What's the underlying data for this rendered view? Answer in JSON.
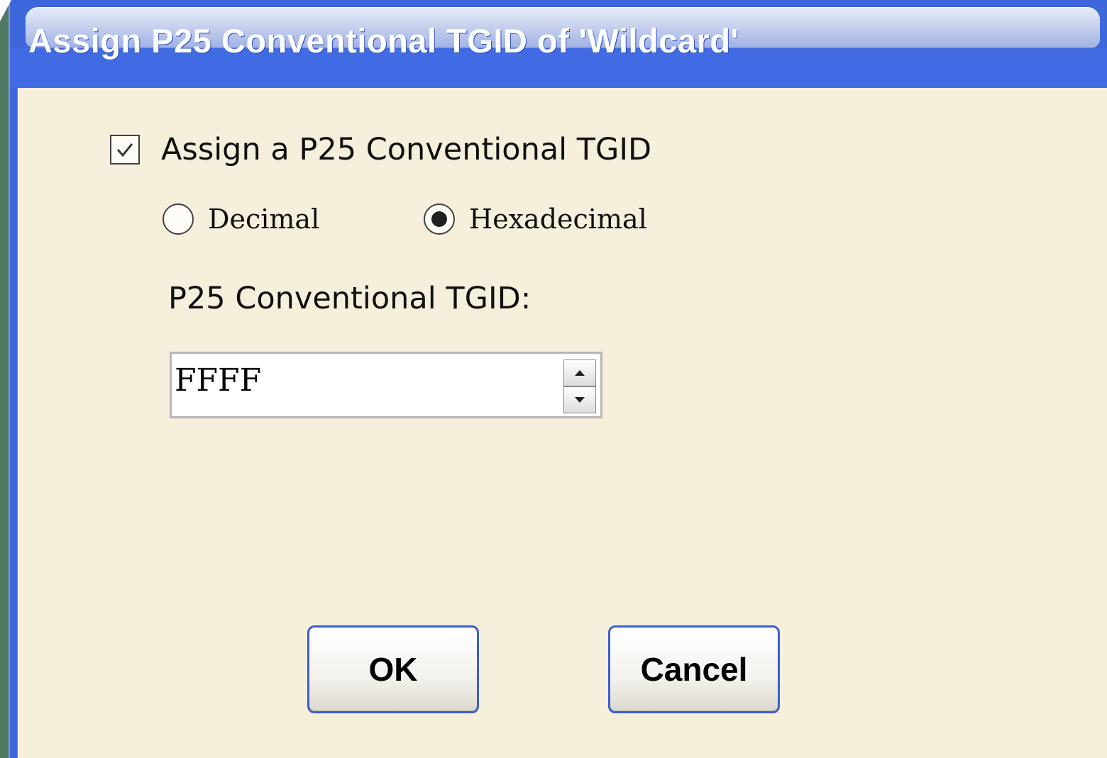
{
  "window": {
    "title": "Assign P25 Conventional TGID of 'Wildcard'"
  },
  "assign_checkbox": {
    "label": "Assign a P25 Conventional TGID",
    "checked": true
  },
  "format": {
    "options": [
      {
        "label": "Decimal",
        "selected": false
      },
      {
        "label": "Hexadecimal",
        "selected": true
      }
    ]
  },
  "tgid_field": {
    "label": "P25 Conventional TGID:",
    "value": "FFFF"
  },
  "buttons": {
    "ok_label": "OK",
    "cancel_label": "Cancel"
  },
  "colors": {
    "title_bar": "#3f67dc",
    "client_bg": "#f5efdc",
    "button_border": "#3a5fcf"
  }
}
